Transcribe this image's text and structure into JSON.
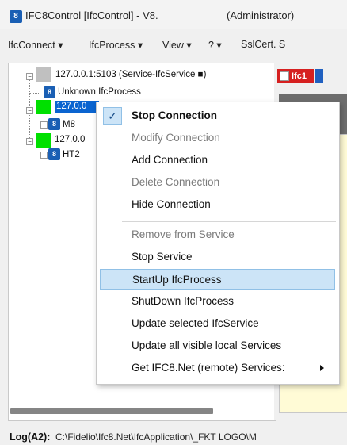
{
  "window": {
    "title": "IFC8Control [IfcControl] - V8.",
    "admin": "(Administrator)",
    "icon": "ifc8-app-icon"
  },
  "menubar": {
    "items": [
      "IfcConnect ▾",
      "IfcProcess ▾",
      "View ▾",
      "? ▾",
      "SslCert. S"
    ]
  },
  "tree": {
    "nodes": [
      {
        "label": "127.0.0.1:5103 (Service-IfcService ■)",
        "square_color": "#c0c0c0"
      },
      {
        "label": "Unknown IfcProcess"
      },
      {
        "label": "127.0.0",
        "square_color": "#00e000",
        "selected": true
      },
      {
        "label": "M8"
      },
      {
        "label": "127.0.0",
        "square_color": "#00e000"
      },
      {
        "label": "HT2"
      }
    ]
  },
  "right_panel": {
    "tab_label": "Ifc1"
  },
  "context_menu": {
    "items": [
      {
        "label": "Stop Connection",
        "checked": true,
        "bold": true
      },
      {
        "label": "Modify Connection",
        "disabled": true
      },
      {
        "label": "Add Connection"
      },
      {
        "label": "Delete Connection",
        "disabled": true
      },
      {
        "label": "Hide Connection"
      },
      {
        "label": "Remove from Service",
        "disabled": true
      },
      {
        "label": "Stop Service"
      },
      {
        "label": "StartUp IfcProcess",
        "highlighted": true
      },
      {
        "label": "ShutDown IfcProcess"
      },
      {
        "label": "Update selected IfcService"
      },
      {
        "label": "Update all visible local Services"
      },
      {
        "label": "Get IFC8.Net (remote) Services:",
        "submenu": true
      }
    ]
  },
  "statusbar": {
    "label": "Log(A2):",
    "path": "C:\\Fidelio\\Ifc8.Net\\IfcApplication\\_FKT LOGO\\M"
  },
  "colors": {
    "highlight": "#cce4f7",
    "selection": "#0a64d0",
    "tab_red": "#d62020"
  }
}
